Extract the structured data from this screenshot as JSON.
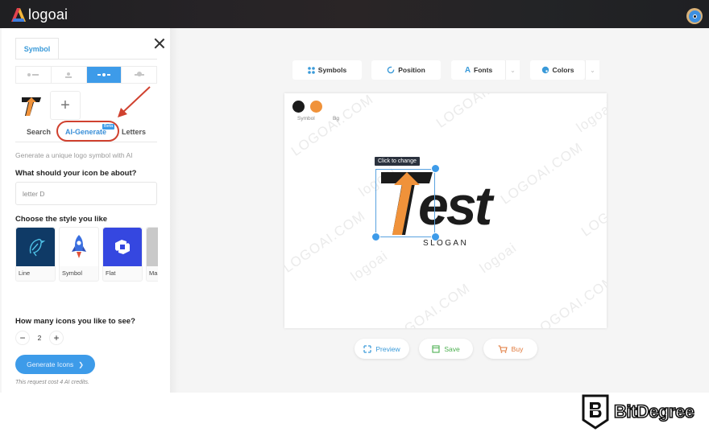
{
  "app": {
    "brand_name": "logoai",
    "brand_colors": {
      "red": "#e2424e",
      "yellow": "#f3b53a",
      "blue": "#3f7fe0"
    }
  },
  "sidebar": {
    "active_tab": "Symbol",
    "layout_options": [
      {
        "name": "symbol-left",
        "active": false
      },
      {
        "name": "symbol-top",
        "active": false
      },
      {
        "name": "symbol-center",
        "active": true
      },
      {
        "name": "symbol-behind",
        "active": false
      }
    ],
    "add_symbol_label": "+",
    "subtabs": [
      {
        "label": "Search",
        "active": false
      },
      {
        "label": "AI-Generate",
        "active": true,
        "badge": "Beta"
      },
      {
        "label": "Letters",
        "active": false
      }
    ],
    "ai": {
      "description": "Generate a unique logo symbol with AI",
      "question_label": "What should your icon be about?",
      "question_value": "letter D",
      "style_label": "Choose the style you like",
      "styles": [
        {
          "label": "Line",
          "bg": "#0f3a66"
        },
        {
          "label": "Symbol",
          "bg": "#ffffff"
        },
        {
          "label": "Flat",
          "bg": "#3547e0"
        },
        {
          "label": "Ma",
          "bg": "#c9c9c9"
        }
      ],
      "count_label": "How many icons you like to see?",
      "count_value": "2",
      "decrement_label": "−",
      "increment_label": "+",
      "generate_label": "Generate Icons",
      "generate_chevron": "❯",
      "cost_note": "This request cost 4 AI credits."
    }
  },
  "toolbar": {
    "symbols_label": "Symbols",
    "position_label": "Position",
    "fonts_label": "Fonts",
    "colors_label": "Colors",
    "caret": "⌄"
  },
  "canvas": {
    "swatches": [
      {
        "label": "Symbol",
        "color": "#1b1b1b"
      },
      {
        "label": "Bg",
        "color": "#f0923a"
      }
    ],
    "tooltip": "Click to change",
    "logo_text": "est",
    "slogan": "SLOGAN",
    "symbol_colors": {
      "arrow": "#f0923a",
      "bar": "#1b1b1b"
    },
    "watermarks": [
      "LOGOAI.COM",
      "logoai"
    ]
  },
  "actions": {
    "preview_label": "Preview",
    "save_label": "Save",
    "buy_label": "Buy",
    "preview_color": "#3a9ad9",
    "save_color": "#4caf50",
    "buy_color": "#e0783a"
  },
  "watermark_brand": {
    "name": "BitDegree"
  }
}
